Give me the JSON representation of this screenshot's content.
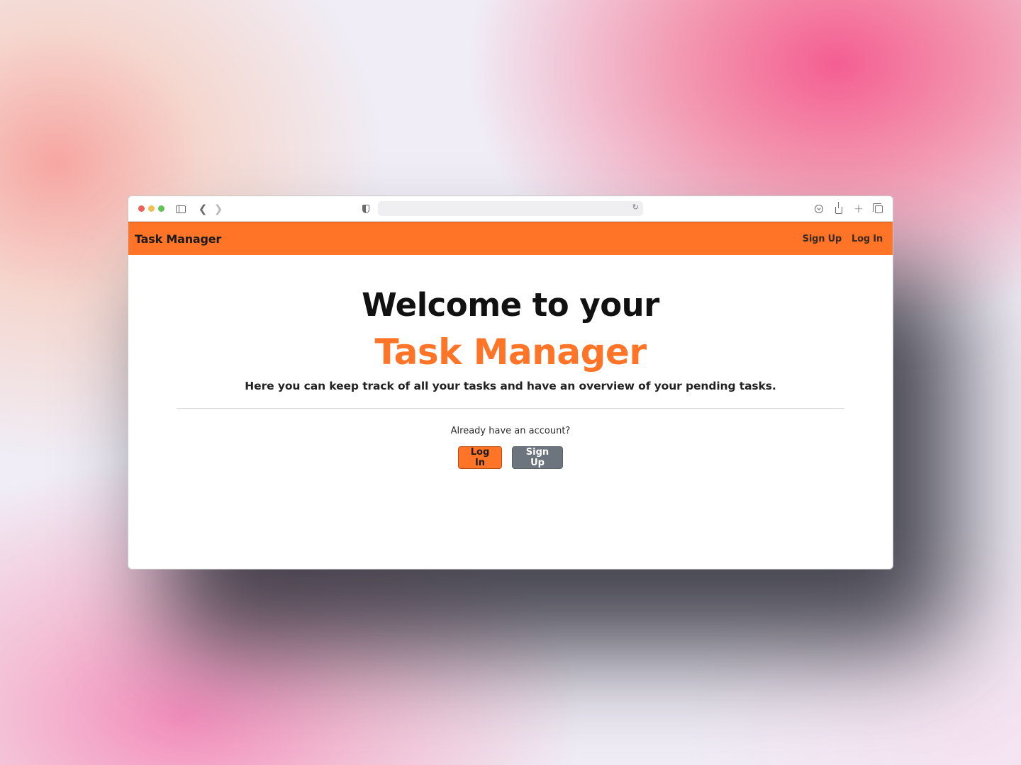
{
  "app": {
    "brand": "Task Manager",
    "accent_color": "#ff7426",
    "secondary_color": "#6c757d"
  },
  "browser": {
    "address_value": "",
    "icons": [
      "sidebar-icon",
      "back-icon",
      "forward-icon",
      "shield-icon",
      "reload-icon",
      "download-icon",
      "share-icon",
      "new-tab-icon",
      "tabs-overview-icon"
    ]
  },
  "navbar": {
    "links": [
      {
        "label": "Sign Up"
      },
      {
        "label": "Log In"
      }
    ]
  },
  "hero": {
    "heading_line1": "Welcome to your",
    "heading_line2": "Task Manager",
    "lead": "Here you can keep track of all your tasks and have an overview of your pending tasks."
  },
  "auth": {
    "prompt": "Already have an account?",
    "login_label": "Log In",
    "signup_label": "Sign Up"
  }
}
